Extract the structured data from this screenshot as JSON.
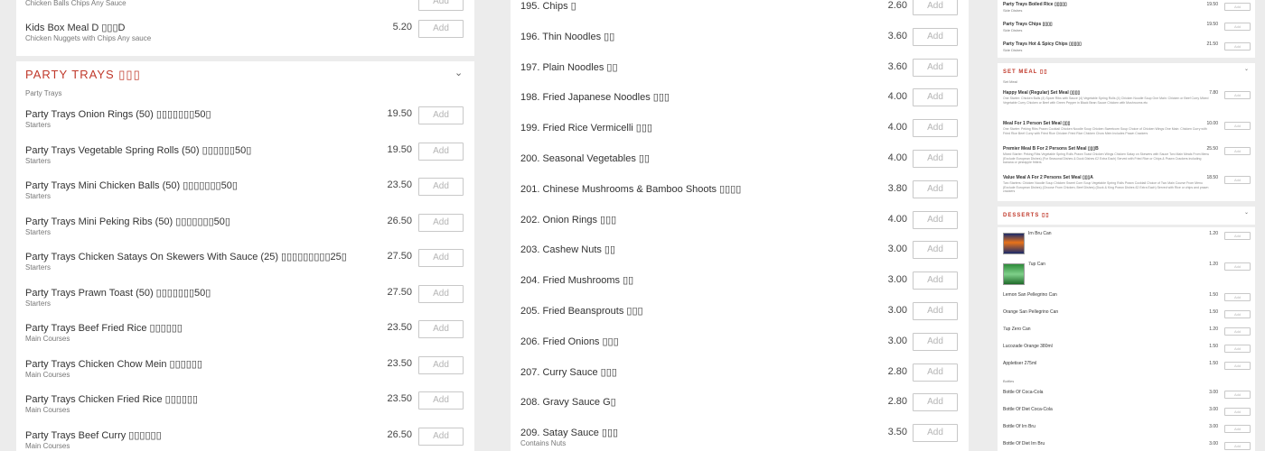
{
  "add_label": "Add",
  "colors": {
    "accent": "#c0392b",
    "background": "#ececec",
    "card": "#ffffff"
  },
  "left_panel": {
    "top_item": {
      "name": "Chicken Balls Chips Any Sauce"
    },
    "kids_item": {
      "name": "Kids Box Meal D ▯▯▯D",
      "sub": "Chicken Nuggets with Chips Any sauce",
      "price": "5.20"
    },
    "section": {
      "title": "PARTY TRAYS ▯▯▯",
      "subtitle": "Party Trays",
      "icon": "chevron-down-icon"
    },
    "items": [
      {
        "name": "Party Trays Onion Rings (50) ▯▯▯▯▯▯▯50▯",
        "sub": "Starters",
        "price": "19.50"
      },
      {
        "name": "Party Trays Vegetable Spring Rolls (50) ▯▯▯▯▯▯50▯",
        "sub": "Starters",
        "price": "19.50"
      },
      {
        "name": "Party Trays Mini Chicken Balls (50) ▯▯▯▯▯▯▯50▯",
        "sub": "Starters",
        "price": "23.50"
      },
      {
        "name": "Party Trays Mini Peking Ribs (50) ▯▯▯▯▯▯▯50▯",
        "sub": "Starters",
        "price": "26.50"
      },
      {
        "name": "Party Trays Chicken Satays On Skewers With Sauce (25) ▯▯▯▯▯▯▯▯▯25▯",
        "sub": "Starters",
        "price": "27.50"
      },
      {
        "name": "Party Trays Prawn Toast (50) ▯▯▯▯▯▯▯50▯",
        "sub": "Starters",
        "price": "27.50"
      },
      {
        "name": "Party Trays Beef Fried Rice ▯▯▯▯▯▯",
        "sub": "Main Courses",
        "price": "23.50"
      },
      {
        "name": "Party Trays Chicken Chow Mein ▯▯▯▯▯▯",
        "sub": "Main Courses",
        "price": "23.50"
      },
      {
        "name": "Party Trays Chicken Fried Rice ▯▯▯▯▯▯",
        "sub": "Main Courses",
        "price": "23.50"
      },
      {
        "name": "Party Trays Beef Curry ▯▯▯▯▯▯",
        "sub": "Main Courses",
        "price": "26.50"
      }
    ]
  },
  "middle_panel": {
    "items": [
      {
        "name": "195. Chips ▯",
        "price": "2.60"
      },
      {
        "name": "196. Thin Noodles ▯▯",
        "price": "3.60"
      },
      {
        "name": "197. Plain Noodles ▯▯",
        "price": "3.60"
      },
      {
        "name": "198. Fried Japanese Noodles ▯▯▯",
        "price": "4.00"
      },
      {
        "name": "199. Fried Rice Vermicelli ▯▯▯",
        "price": "4.00"
      },
      {
        "name": "200. Seasonal Vegetables ▯▯",
        "price": "4.00"
      },
      {
        "name": "201. Chinese Mushrooms & Bamboo Shoots ▯▯▯▯",
        "price": "3.80"
      },
      {
        "name": "202. Onion Rings ▯▯▯",
        "price": "4.00"
      },
      {
        "name": "203. Cashew Nuts ▯▯",
        "price": "3.00"
      },
      {
        "name": "204. Fried Mushrooms ▯▯",
        "price": "3.00"
      },
      {
        "name": "205. Fried Beansprouts ▯▯▯",
        "price": "3.00"
      },
      {
        "name": "206. Fried Onions ▯▯▯",
        "price": "3.00"
      },
      {
        "name": "207. Curry Sauce ▯▯▯",
        "price": "2.80"
      },
      {
        "name": "208. Gravy Sauce G▯",
        "price": "2.80"
      },
      {
        "name": "209. Satay Sauce ▯▯▯",
        "sub": "Contains Nuts",
        "price": "3.50"
      }
    ]
  },
  "right_panel": {
    "side_items": [
      {
        "name": "Party Trays Boiled Rice ▯▯▯▯▯",
        "sub": "Side Dishes",
        "price": "19.50"
      },
      {
        "name": "Party Trays Chips ▯▯▯▯",
        "sub": "Side Dishes",
        "price": "19.50"
      },
      {
        "name": "Party Trays Hot & Spicy Chips ▯▯▯▯▯",
        "sub": "Side Dishes",
        "price": "21.50"
      }
    ],
    "set_meal": {
      "title": "SET MEAL ▯▯",
      "subtitle": "Set Meal",
      "items": [
        {
          "name": "Happy Meal (Regular) Set Meal ▯▯▯▯",
          "desc": "One Starter: Chicken Balls (4) Spare Ribs with Sauce (4) Vegetable Spring Rolls (4) Chicken Noodle Soup One Main: Chicken or Beef Curry Mixed Vegetable Curry Chicken or Beef with Green Pepper in Black Bean Sauce Chicken with Mushrooms etc",
          "price": "7.80"
        },
        {
          "name": "Meal For 1 Person Set Meal ▯▯▯",
          "desc": "One Starter: Peking Ribs Prawn Cocktail Chicken Noodle Soup Chicken Sweetcorn Soup Choice of Chicken Wings One Main: Chicken Curry with Fried Rice Beef Curry with Fried Rice Chicken Fried Rice Chicken Chow Mein Includes Prawn Crackers",
          "price": "10.00"
        },
        {
          "name": "Premier Meal B For 2 Persons Set Meal ▯▯▯B",
          "desc": "Mixed Starter: Peking Ribs Vegetable Spring Rolls Prawn Toast Chicken Wings Chicken Satay on Skewers with Sauce Two Main Meals From Menu (Exclude European Dishes) (For Seasonal Dishes & Duck Dishes £2 Extra Each) Served with Fried Rice or Chips & Prawn Crackers including banana or pineapple fritters",
          "price": "25.50"
        },
        {
          "name": "Value Meal A For 2 Persons Set Meal ▯▯▯A",
          "desc": "Two Starters: Chicken Noodle Soup Chicken Sweet Corn Soup Vegetable Spring Rolls Prawn Cocktail Choice of Two Main Course From Menu (Exclude European Dishes) (Choose From Chicken, Beef Dishes) (Duck & King Prawn Dishes £2 Extra Each) Served with Rice or chips and prawn crackers",
          "price": "18.50"
        }
      ]
    },
    "desserts": {
      "title": "DESSERTS ▯▯",
      "items": [
        {
          "name": "Irn Bru Can",
          "price": "1.20",
          "thumb": "irn-bru-can"
        },
        {
          "name": "7up Can",
          "price": "1.20",
          "thumb": "7up-can"
        },
        {
          "name": "Lemon San Pellegrino Can",
          "price": "1.50"
        },
        {
          "name": "Orange San Pellegrino Can",
          "price": "1.50"
        },
        {
          "name": "7up Zero Can",
          "price": "1.20"
        },
        {
          "name": "Lucozade Orange 380ml",
          "price": "1.50"
        },
        {
          "name": "Appletiser 275ml",
          "price": "1.50"
        }
      ],
      "bottles_label": "Bottles",
      "bottles": [
        {
          "name": "Bottle Of Coca-Cola",
          "price": "3.00"
        },
        {
          "name": "Bottle Of Diet Coca-Cola",
          "price": "3.00"
        },
        {
          "name": "Bottle Of Irn Bru",
          "price": "3.00"
        },
        {
          "name": "Bottle Of Diet Irn Bru",
          "price": "3.00"
        }
      ]
    }
  }
}
